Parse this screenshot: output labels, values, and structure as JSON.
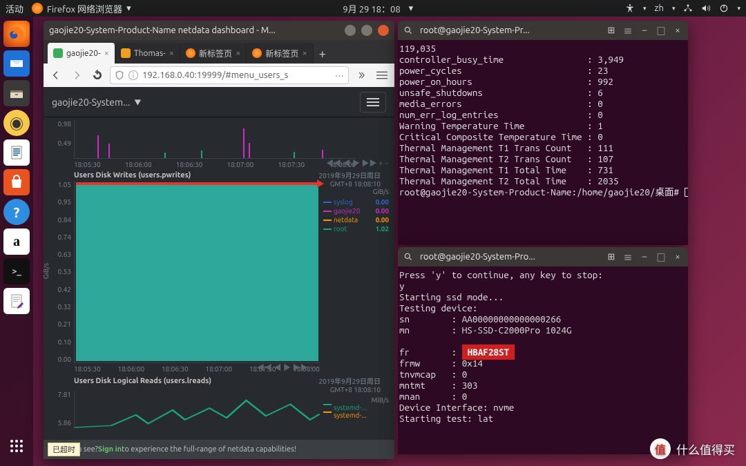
{
  "topbar": {
    "activities": "活动",
    "app_label": "Firefox 网络浏览器",
    "datetime": "9月 29 18：08",
    "lang": "zh"
  },
  "launcher": {
    "apps": [
      {
        "name": "firefox",
        "glyph": ""
      },
      {
        "name": "thunderbird",
        "glyph": ""
      },
      {
        "name": "files",
        "glyph": "🗂"
      },
      {
        "name": "rhythmbox",
        "glyph": "◉"
      },
      {
        "name": "writer",
        "glyph": "📄"
      },
      {
        "name": "store",
        "glyph": "A"
      },
      {
        "name": "help",
        "glyph": "?"
      },
      {
        "name": "amazon",
        "glyph": "a"
      },
      {
        "name": "terminal",
        "glyph": ">_"
      },
      {
        "name": "text-editor",
        "glyph": "✎"
      }
    ]
  },
  "firefox": {
    "title": "gaojie20-System-Product-Name netdata dashboard - M...",
    "tabs": [
      {
        "label": "gaojie20-",
        "active": true,
        "icon": "netdata"
      },
      {
        "label": "Thomas-",
        "active": false,
        "icon": "t"
      },
      {
        "label": "新标签页",
        "active": false,
        "icon": "ff"
      },
      {
        "label": "新标签页",
        "active": false,
        "icon": "ff"
      }
    ],
    "url": "192.168.0.40:19999/#menu_users_s",
    "netdata": {
      "brand": "gaojie20-System...",
      "chart1_ticks": [
        "0.98",
        "0.49"
      ],
      "chart1_x": [
        "18:05:30",
        "18:06:00",
        "18:06:30",
        "18:07:00",
        "18:07:30",
        "18:08:00"
      ],
      "chart2_title": "Users Disk Writes (users.pwrites)",
      "chart2_stamp_line1": "2019年9月29日周日",
      "chart2_stamp_line2": "GMT+8 18:08:10",
      "chart2_yticks": [
        "1.05",
        "0.95",
        "0.84",
        "0.74",
        "0.63",
        "0.53",
        "0.42",
        "0.32",
        "0.21",
        "0.10",
        "0.00"
      ],
      "chart2_x": [
        "18:05:30",
        "18:06:00",
        "18:06:30",
        "18:07:00",
        "18:07:30",
        "18:08:00"
      ],
      "chart2_ylabel": "GiB/s",
      "legend_unit": "GiB/s",
      "legend2": [
        {
          "name": "syslog",
          "color": "#3366cc",
          "value": "0.00"
        },
        {
          "name": "gaojie20",
          "color": "#d02cc4",
          "value": "0.00"
        },
        {
          "name": "netdata",
          "color": "#ff9900",
          "value": "0.00"
        },
        {
          "name": "root",
          "color": "#1aa57d",
          "value": "1.02"
        }
      ],
      "chart3_title": "Users Disk Logical Reads (users.lreads)",
      "chart3_yticks": [
        "7.81",
        "5.86"
      ],
      "chart3_unit": "MiB/s",
      "legend3": [
        {
          "name": "systemd-...",
          "color": "#1aa57d",
          "value": ""
        },
        {
          "name": "systemd-...",
          "color": "#ff9900",
          "value": ""
        }
      ],
      "banner_before": "what you see? ",
      "banner_signin": "Sign in",
      "banner_after": " to experience the full-range of netdata capabilities!",
      "timeout": "已超时"
    }
  },
  "term1": {
    "title": "root@gaojie20-System-Pr...",
    "lines": [
      "119,035",
      "controller_busy_time                : 3,949",
      "power_cycles                        : 23",
      "power_on_hours                      : 992",
      "unsafe_shutdowns                    : 6",
      "media_errors                        : 0",
      "num_err_log_entries                 : 0",
      "Warning Temperature Time            : 1",
      "Critical Composite Temperature Time : 0",
      "Thermal Management T1 Trans Count   : 111",
      "Thermal Management T2 Trans Count   : 107",
      "Thermal Management T1 Total Time    : 731",
      "Thermal Management T2 Total Time    : 2035"
    ],
    "prompt": "root@gaojie20-System-Product-Name:/home/gaojie20/桌面# "
  },
  "term2": {
    "title": "root@gaojie20-System-Pro...",
    "lines_top": [
      "Press 'y' to continue, any key to stop:",
      "y",
      "Starting ssd mode...",
      "Testing device:",
      "sn        : AA00000000000000266",
      "mn        : HS-SSD-C2000Pro 1024G",
      ""
    ],
    "fr_label": "fr        : ",
    "fr_value": "HBAF28ST",
    "lines_bottom": [
      "frmw      : 0x14",
      "tnvmcap   : 0",
      "mntmt     : 303",
      "mnan      : 0",
      "Device Interface: nvme",
      "Starting test: lat"
    ]
  },
  "chart_data": {
    "type": "area",
    "title": "Users Disk Writes (users.pwrites)",
    "ylabel": "GiB/s",
    "ylim": [
      0.0,
      1.05
    ],
    "x": [
      "18:05:30",
      "18:06:00",
      "18:06:30",
      "18:07:00",
      "18:07:30",
      "18:08:00"
    ],
    "series": [
      {
        "name": "syslog",
        "color": "#3366cc",
        "latest": 0.0
      },
      {
        "name": "gaojie20",
        "color": "#d02cc4",
        "latest": 0.0
      },
      {
        "name": "netdata",
        "color": "#ff9900",
        "latest": 0.0
      },
      {
        "name": "root",
        "color": "#1aa57d",
        "latest": 1.02
      }
    ],
    "note": "root series saturates at ~1.05 GiB/s across visible window; others near zero"
  },
  "watermark": {
    "text": "什么值得买",
    "badge": "值"
  }
}
